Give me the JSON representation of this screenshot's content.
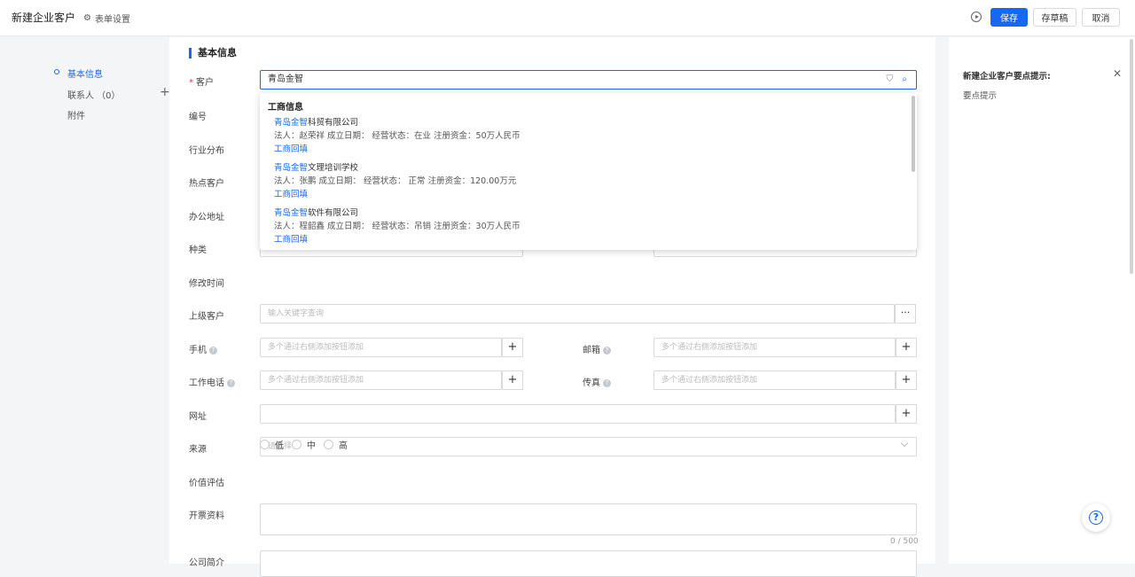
{
  "header": {
    "title": "新建企业客户",
    "form_settings": "表单设置",
    "save": "保存",
    "draft": "存草稿",
    "cancel": "取消"
  },
  "nav": {
    "items": [
      {
        "label": "基本信息"
      },
      {
        "label": "联系人 （0）"
      },
      {
        "label": "附件"
      }
    ]
  },
  "form": {
    "section_title": "基本信息",
    "fields": {
      "customer": {
        "label": "客户",
        "value": "青岛金智"
      },
      "number": {
        "label": "编号"
      },
      "industry": {
        "label": "行业分布"
      },
      "hot": {
        "label": "热点客户"
      },
      "office": {
        "label": "办公地址"
      },
      "kind": {
        "label": "种类"
      },
      "modified": {
        "label": "修改时间"
      },
      "parent": {
        "label": "上级客户",
        "placeholder": "输入关键字查询"
      },
      "mobile": {
        "label": "手机",
        "placeholder": "多个通过右侧添加按钮添加"
      },
      "email": {
        "label": "邮箱",
        "placeholder": "多个通过右侧添加按钮添加"
      },
      "workphone": {
        "label": "工作电话",
        "placeholder": "多个通过右侧添加按钮添加"
      },
      "fax": {
        "label": "传真",
        "placeholder": "多个通过右侧添加按钮添加"
      },
      "website": {
        "label": "网址"
      },
      "source": {
        "label": "来源",
        "placeholder": "请选择"
      },
      "value_eval": {
        "label": "价值评估",
        "options": [
          "低",
          "中",
          "高"
        ]
      },
      "invoice": {
        "label": "开票资料",
        "counter": "0 / 500"
      },
      "intro": {
        "label": "公司简介"
      }
    }
  },
  "dropdown": {
    "title": "工商信息",
    "entries": [
      {
        "highlight": "青岛金智",
        "rest": "科贸有限公司",
        "meta": "法人：赵荣祥 成立日期：  经营状态：在业 注册资金：50万人民币",
        "action": "工商回填"
      },
      {
        "highlight": "青岛金智",
        "rest": "文理培训学校",
        "meta": "法人：张鹏 成立日期：  经营状态：  正常 注册资金：120.00万元",
        "action": "工商回填"
      },
      {
        "highlight": "青岛金智",
        "rest": "软件有限公司",
        "meta": "法人：程韶鑫 成立日期：  经营状态：吊销 注册资金：30万人民币",
        "action": "工商回填"
      }
    ]
  },
  "tips": {
    "title": "新建企业客户要点提示:",
    "body": "要点提示"
  }
}
